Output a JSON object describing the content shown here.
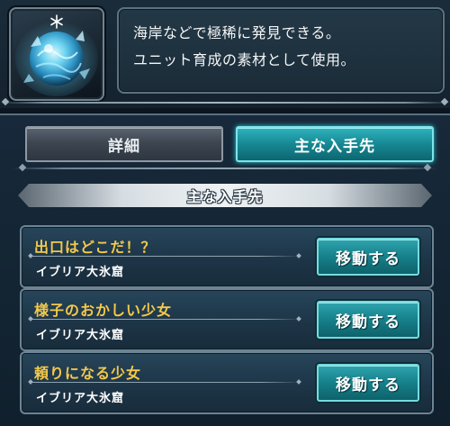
{
  "item": {
    "icon": "frost-crystal-orb-icon",
    "description_lines": [
      "海岸などで極稀に発見できる。",
      "ユニット育成の素材として使用。"
    ]
  },
  "tabs": [
    {
      "label": "詳細",
      "active": false
    },
    {
      "label": "主な入手先",
      "active": true
    }
  ],
  "section": {
    "title": "主な入手先"
  },
  "sources": [
    {
      "title": "出口はどこだ！？",
      "place": "イブリア大氷窟",
      "button": "移動する"
    },
    {
      "title": "様子のおかしい少女",
      "place": "イブリア大氷窟",
      "button": "移動する"
    },
    {
      "title": "頼りになる少女",
      "place": "イブリア大氷窟",
      "button": "移動する"
    }
  ],
  "colors": {
    "accent": "#1a8f99",
    "title_gold": "#f4c94a",
    "panel": "#17293a"
  }
}
